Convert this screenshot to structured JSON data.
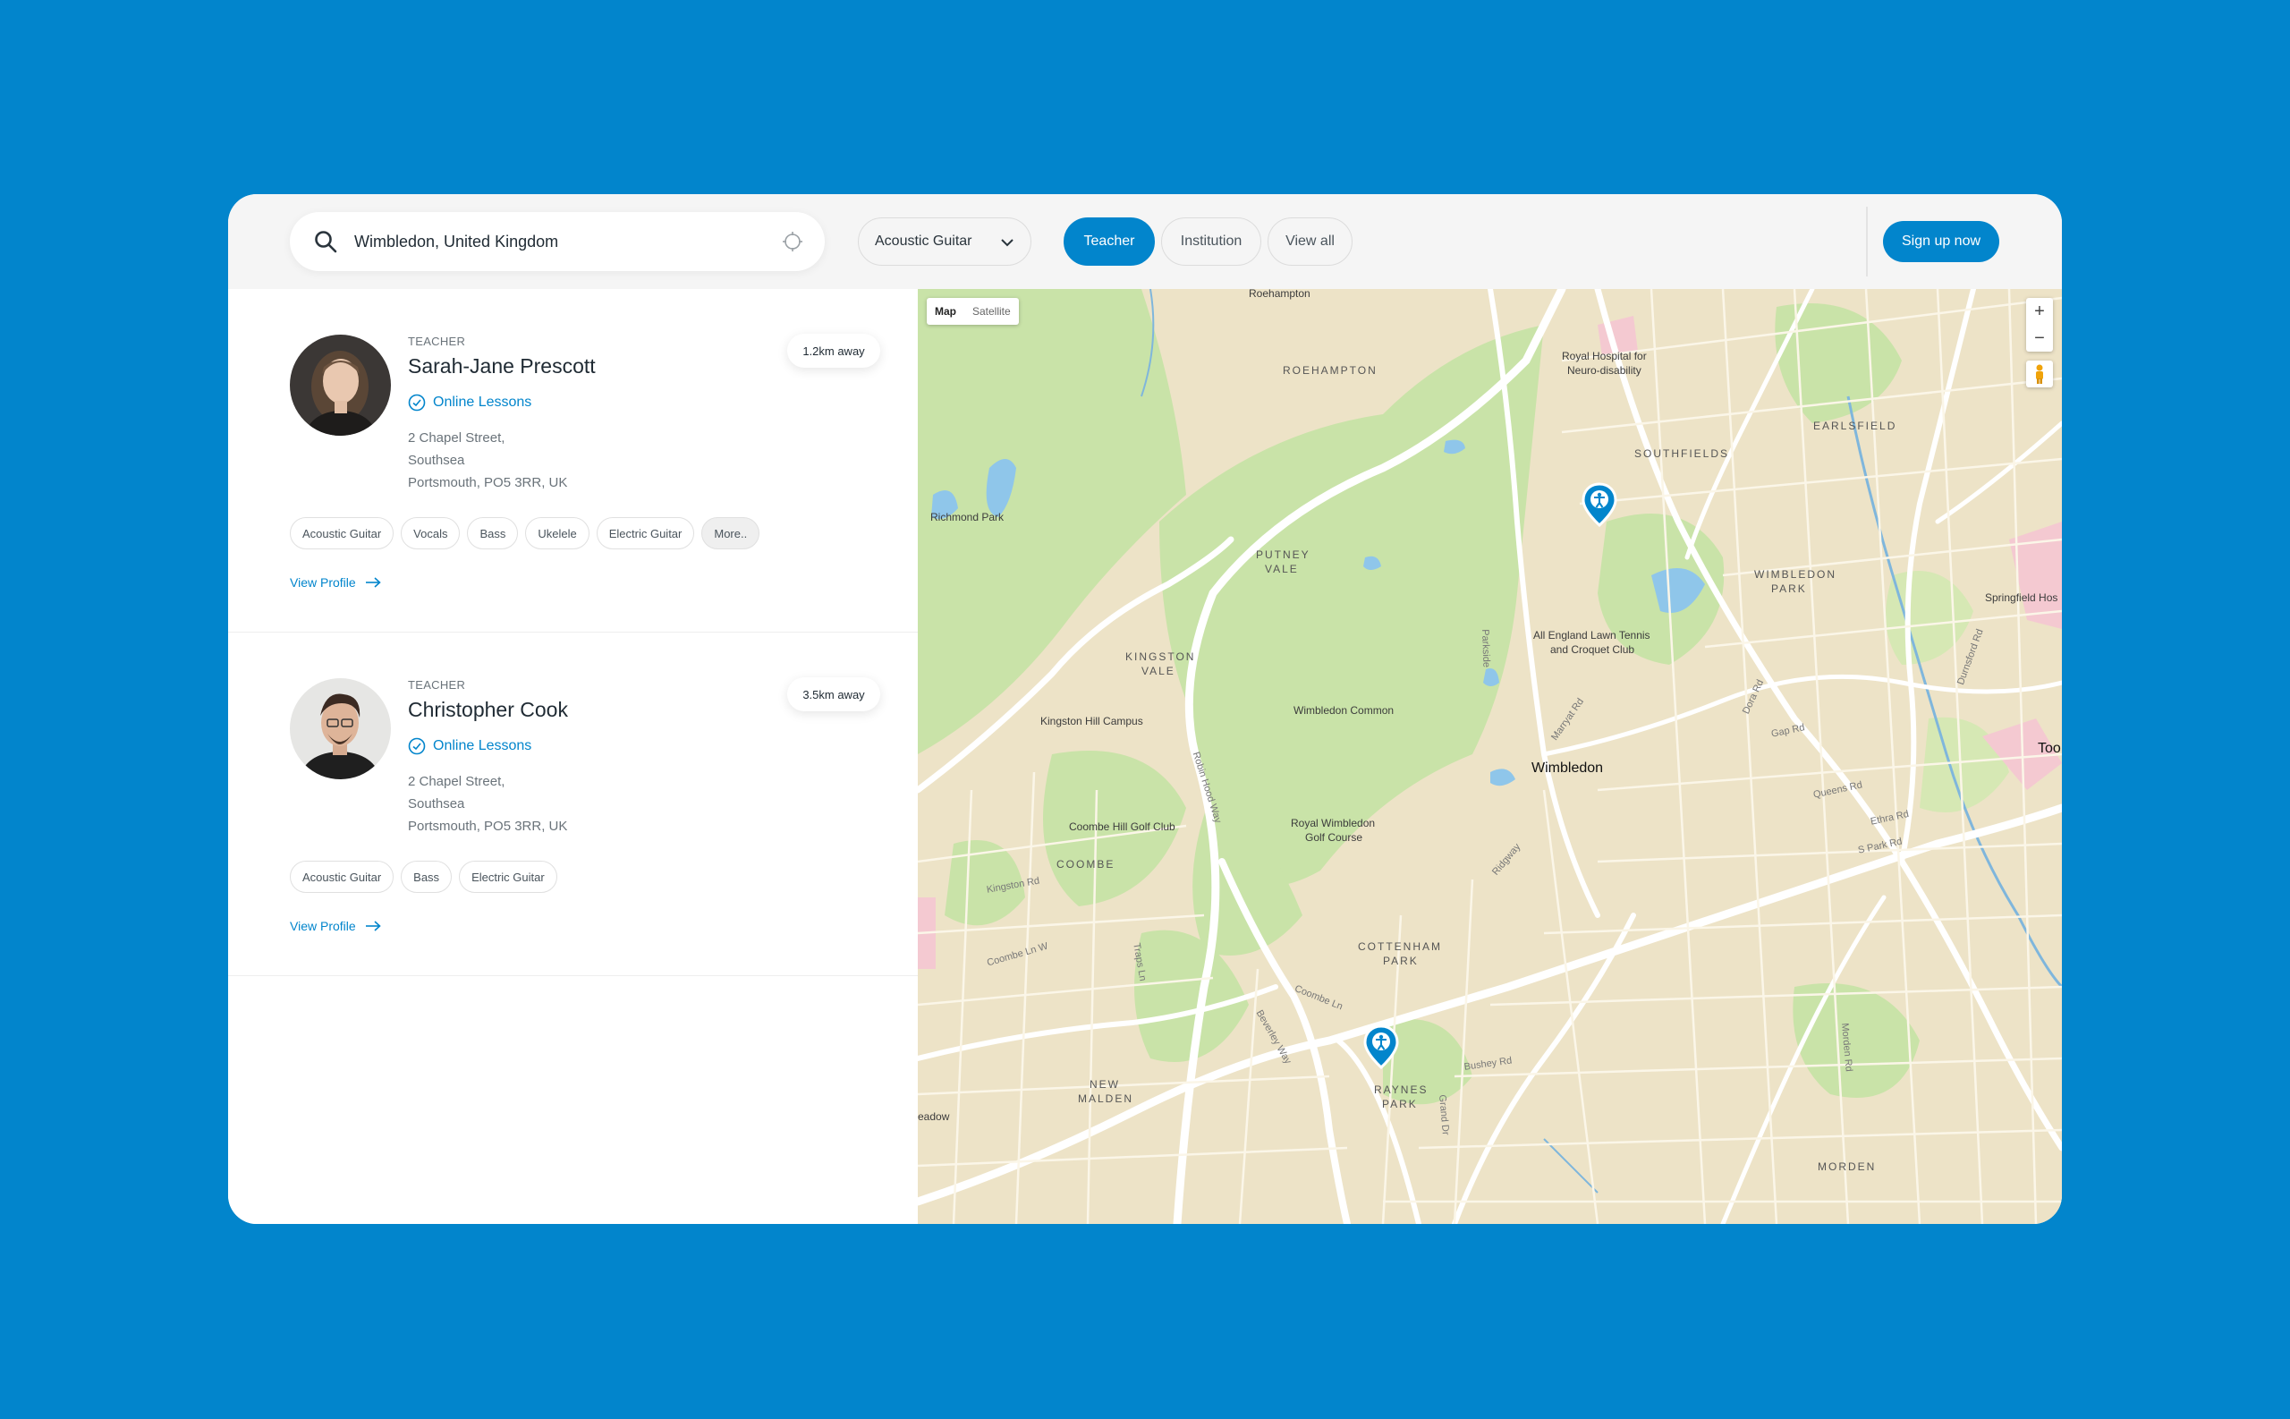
{
  "search": {
    "value": "Wimbledon, United Kingdom",
    "placeholder": ""
  },
  "instrument_filter": {
    "selected": "Acoustic Guitar"
  },
  "type_filters": [
    {
      "label": "Teacher",
      "active": true
    },
    {
      "label": "Institution",
      "active": false
    },
    {
      "label": "View all",
      "active": false
    }
  ],
  "signup_label": "Sign up now",
  "results": [
    {
      "role": "TEACHER",
      "name": "Sarah-Jane Prescott",
      "online": "Online Lessons",
      "address": [
        "2 Chapel Street,",
        "Southsea",
        "Portsmouth, PO5 3RR, UK"
      ],
      "distance": "1.2km away",
      "tags": [
        "Acoustic Guitar",
        "Vocals",
        "Bass",
        "Ukelele",
        "Electric Guitar",
        "More.."
      ],
      "view_profile": "View Profile"
    },
    {
      "role": "TEACHER",
      "name": "Christopher Cook",
      "online": "Online Lessons",
      "address": [
        "2 Chapel Street,",
        "Southsea",
        "Portsmouth, PO5 3RR, UK"
      ],
      "distance": "3.5km away",
      "tags": [
        "Acoustic Guitar",
        "Bass",
        "Electric Guitar"
      ],
      "view_profile": "View Profile"
    }
  ],
  "map": {
    "type_map": "Map",
    "type_satellite": "Satellite",
    "zoom_in": "+",
    "zoom_out": "−",
    "labels": {
      "roehampton_top": "Roehampton",
      "roehampton": "ROEHAMPTON",
      "royal_hospital_1": "Royal Hospital for",
      "royal_hospital_2": "Neuro-disability",
      "earlsfield": "EARLSFIELD",
      "southfields": "SOUTHFIELDS",
      "richmond_park": "Richmond Park",
      "putney_vale_1": "PUTNEY",
      "putney_vale_2": "VALE",
      "wimbledon_park_1": "WIMBLEDON",
      "wimbledon_park_2": "PARK",
      "springfield": "Springfield Hos",
      "kingston_vale_1": "KINGSTON",
      "kingston_vale_2": "VALE",
      "all_england_1": "All England Lawn Tennis",
      "all_england_2": "and Croquet Club",
      "kingston_hill": "Kingston Hill Campus",
      "wimbledon_common": "Wimbledon Common",
      "wimbledon": "Wimbledon",
      "tooting": "Too",
      "coombe_hill": "Coombe Hill Golf Club",
      "royal_wimbledon_1": "Royal Wimbledon",
      "royal_wimbledon_2": "Golf Course",
      "coombe": "COOMBE",
      "cottenham_1": "COTTENHAM",
      "cottenham_2": "PARK",
      "new_malden_1": "NEW",
      "new_malden_2": "MALDEN",
      "raynes_1": "RAYNES",
      "raynes_2": "PARK",
      "meadow": "eadow",
      "morden": "MORDEN",
      "parkside": "Parkside",
      "robin_hood": "Robin Hood Way",
      "coombe_ln_w": "Coombe Ln W",
      "coombe_ln": "Coombe Ln",
      "beverley_way": "Beverley Way",
      "bushey_rd": "Bushey Rd",
      "gap_rd": "Gap Rd",
      "queens_rd": "Queens Rd",
      "ethra_rd": "Ethra Rd",
      "s_park_rd": "S Park Rd",
      "durnsford": "Durnsford Rd",
      "ridgway": "Ridgway",
      "traps_ln": "Traps Ln",
      "kingston_rd": "Kingston Rd",
      "grand_dr": "Grand Dr",
      "morden_rd": "Morden Rd",
      "marryat": "Marryat Rd",
      "dora_rd": "Dora Rd"
    }
  },
  "colors": {
    "brand": "#0285cc",
    "map_land": "#ede3c7",
    "map_park": "#c9e3a8",
    "map_water": "#8fc6ea"
  }
}
